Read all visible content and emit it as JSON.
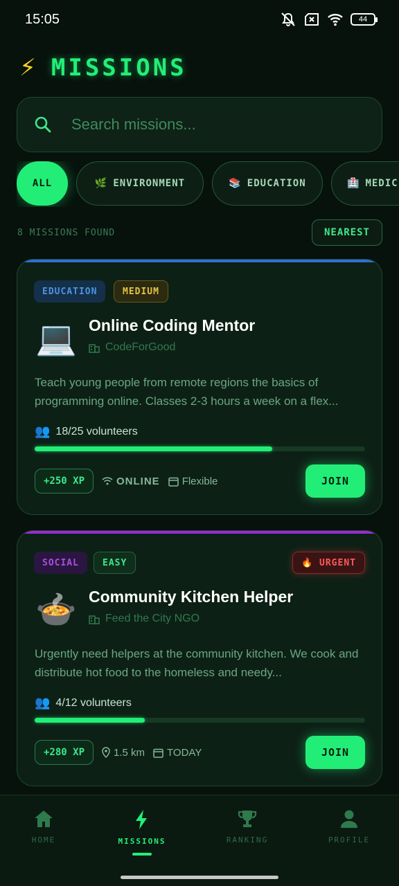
{
  "status_bar": {
    "time": "15:05",
    "battery": "44"
  },
  "header": {
    "title": "MISSIONS"
  },
  "search": {
    "placeholder": "Search missions..."
  },
  "filters": [
    {
      "label": "ALL",
      "icon": "",
      "active": true
    },
    {
      "label": "ENVIRONMENT",
      "icon": "🌿"
    },
    {
      "label": "EDUCATION",
      "icon": "📚"
    },
    {
      "label": "MEDIC",
      "icon": "🏥"
    }
  ],
  "results": {
    "count_text": "8 MISSIONS FOUND",
    "sort_label": "NEAREST"
  },
  "missions": [
    {
      "category": "EDUCATION",
      "difficulty": "MEDIUM",
      "urgent": "",
      "emoji": "💻",
      "title": "Online Coding Mentor",
      "org": "CodeForGood",
      "description": "Teach young people from remote regions the basics of programming online. Classes 2-3 hours a week on a flex...",
      "volunteers": "18/25 volunteers",
      "progress": 0.72,
      "xp": "+250 XP",
      "location": "ONLINE",
      "schedule": "Flexible",
      "join_label": "JOIN",
      "accent": "#2f6fd6"
    },
    {
      "category": "SOCIAL",
      "difficulty": "EASY",
      "urgent": "🔥 URGENT",
      "emoji": "🍲",
      "title": "Community Kitchen Helper",
      "org": "Feed the City NGO",
      "description": "Urgently need helpers at the community kitchen. We cook and distribute hot food to the homeless and needy...",
      "volunteers": "4/12 volunteers",
      "progress": 0.333,
      "xp": "+280 XP",
      "location": "1.5 km",
      "schedule": "TODAY",
      "join_label": "JOIN",
      "accent": "#9a2ad6"
    }
  ],
  "nav": [
    {
      "label": "HOME",
      "icon": "home-icon"
    },
    {
      "label": "MISSIONS",
      "icon": "bolt-icon",
      "active": true
    },
    {
      "label": "RANKING",
      "icon": "trophy-icon"
    },
    {
      "label": "PROFILE",
      "icon": "person-icon"
    }
  ]
}
